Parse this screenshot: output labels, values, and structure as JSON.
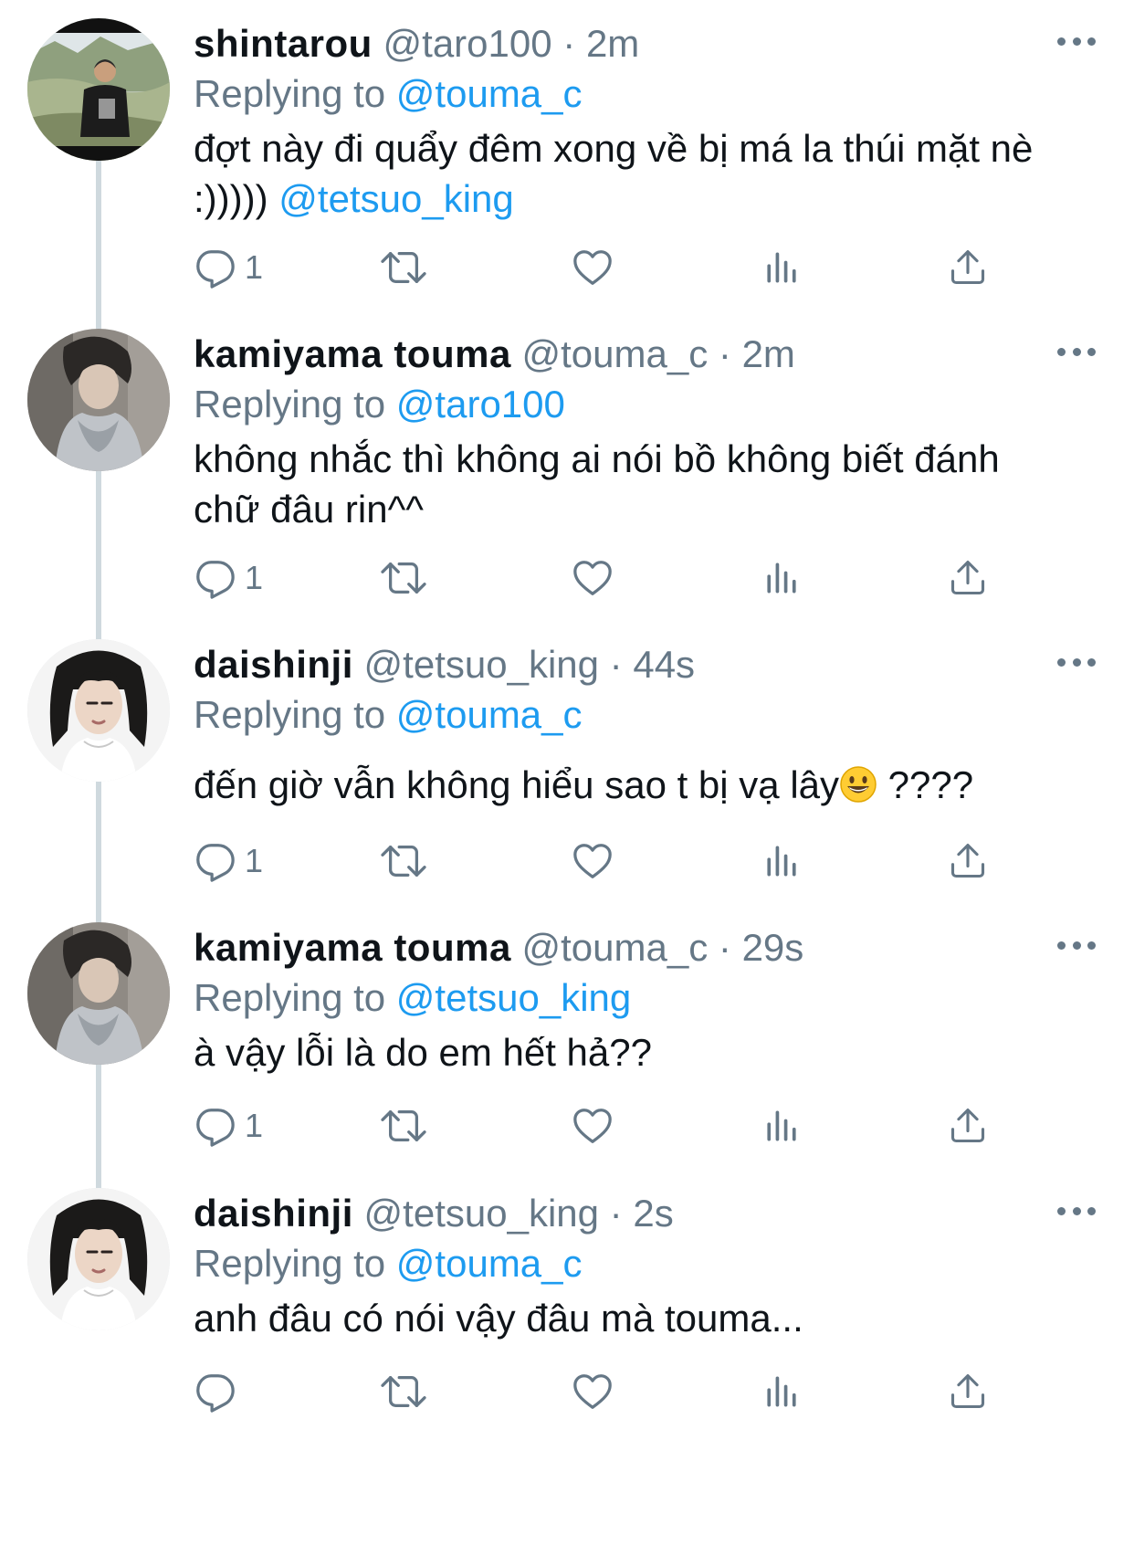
{
  "colors": {
    "text": "#0f1419",
    "secondary": "#657786",
    "link": "#1d9bf0",
    "thread_line": "#cfd9de"
  },
  "icons": {
    "reply": "reply-icon",
    "retweet": "retweet-icon",
    "like": "heart-icon",
    "analytics": "analytics-icon",
    "share": "share-icon",
    "more": "more-icon"
  },
  "tweets": [
    {
      "display_name": "shintarou",
      "handle": "@taro100",
      "separator": "·",
      "time": "2m",
      "replying_label": "Replying to",
      "replying_to": "@touma_c",
      "text": "đợt này đi quẩy đêm xong về bị má la thúi mặt nè :)))))",
      "mention_text": "@tetsuo_king",
      "reply_count": "1"
    },
    {
      "display_name": "kamiyama touma",
      "handle": "@touma_c",
      "separator": "·",
      "time": "2m",
      "replying_label": "Replying to",
      "replying_to": "@taro100",
      "text": "không nhắc thì không ai nói bồ không biết đánh chữ đâu rin^^",
      "reply_count": "1"
    },
    {
      "display_name": "daishinji",
      "handle": "@tetsuo_king",
      "separator": "·",
      "time": "44s",
      "replying_label": "Replying to",
      "replying_to": "@touma_c",
      "text": "đến giờ vẫn không hiểu sao t bị vạ lây",
      "text_after_emoji": " ????",
      "reply_count": "1"
    },
    {
      "display_name": "kamiyama touma",
      "handle": "@touma_c",
      "separator": "·",
      "time": "29s",
      "replying_label": "Replying to",
      "replying_to": "@tetsuo_king",
      "text": "à vậy lỗi là do em hết hả??",
      "reply_count": "1"
    },
    {
      "display_name": "daishinji",
      "handle": "@tetsuo_king",
      "separator": "·",
      "time": "2s",
      "replying_label": "Replying to",
      "replying_to": "@touma_c",
      "text": "anh đâu có nói vậy đâu mà touma...",
      "reply_count": ""
    }
  ]
}
